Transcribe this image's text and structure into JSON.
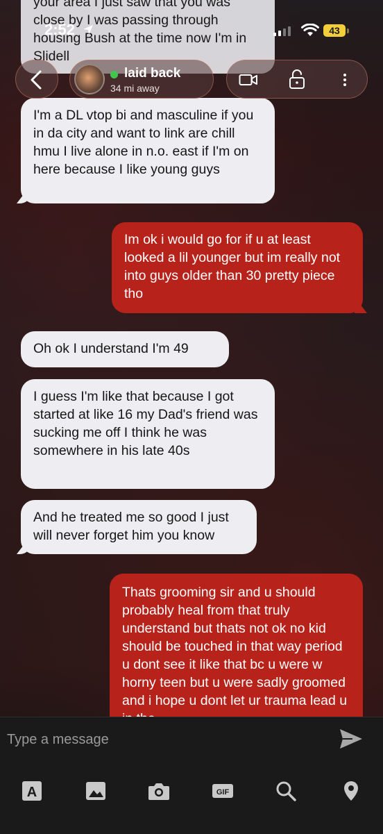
{
  "status_bar": {
    "time": "2:52",
    "battery": "43"
  },
  "header": {
    "name": "laid back",
    "distance": "34 mi away"
  },
  "messages": [
    {
      "from": "them",
      "text": "your area I just saw that you was close by I was passing through housing Bush at the time now I'm in Slidell"
    },
    {
      "from": "them",
      "text": "I'm a DL vtop bi and masculine if you in da city and want to link are chill hmu I live alone in n.o. east if I'm on here because I like young guys"
    },
    {
      "from": "me",
      "text": "Im ok i would go for if u at least looked a lil younger but im really not into guys older than 30 pretty piece tho"
    },
    {
      "from": "them",
      "text": "Oh ok I understand I'm 49"
    },
    {
      "from": "them",
      "text": "I guess I'm like that because I got started at like 16 my Dad's friend was sucking me off I think he was somewhere in his late 40s"
    },
    {
      "from": "them",
      "text": "And he treated me so good I just will never forget him you know"
    },
    {
      "from": "me",
      "text": "Thats grooming sir and u should probably heal from that truly understand but thats not ok no kid should be touched in that way period u dont see it like that bc u were w horny teen but u were sadly groomed and i hope u dont let ur trauma lead u in the"
    }
  ],
  "composer": {
    "placeholder": "Type a message"
  },
  "toolbar": {
    "items": [
      {
        "icon": "text-format-icon",
        "glyph": "A"
      },
      {
        "icon": "photo-icon"
      },
      {
        "icon": "camera-icon"
      },
      {
        "icon": "gif-icon",
        "glyph": "GIF"
      },
      {
        "icon": "search-icon"
      },
      {
        "icon": "location-pin-icon"
      }
    ]
  },
  "colors": {
    "sent_bubble": "#b7221a",
    "received_bubble": "#eeeef2",
    "online": "#3ec94e",
    "battery": "#f2cf3a"
  }
}
